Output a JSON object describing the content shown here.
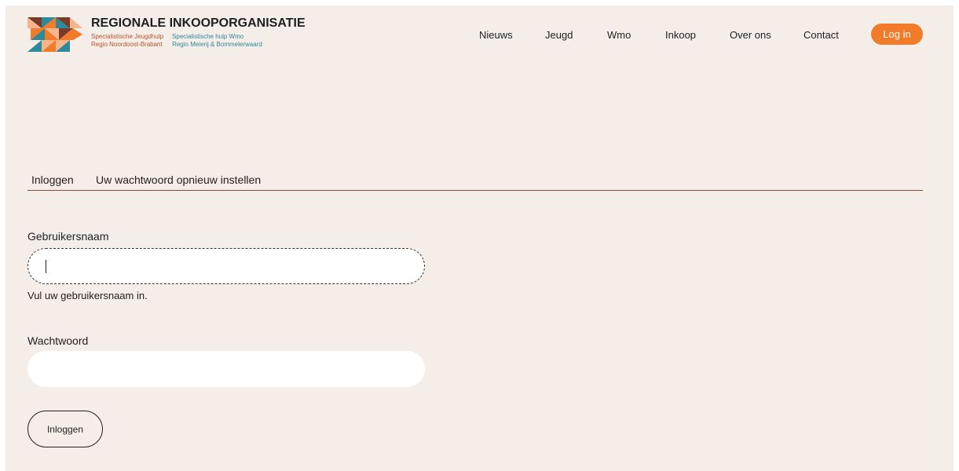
{
  "brand": {
    "title": "REGIONALE INKOOPORGANISATIE",
    "col1_line1": "Specialistische Jeugdhulp",
    "col1_line2": "Regio Noordoost-Brabant",
    "col2_line1": "Specialistische hulp Wmo",
    "col2_line2": "Regio Meierij & Bommelerwaard",
    "colors": {
      "orange": "#f27b29",
      "rust": "#b8542a",
      "teal": "#2d8a98",
      "brown": "#7a3a2a",
      "peach": "#f5b48c"
    }
  },
  "nav": {
    "items": [
      "Nieuws",
      "Jeugd",
      "Wmo",
      "Inkoop",
      "Over ons",
      "Contact"
    ],
    "login_label": "Log in"
  },
  "tabs": [
    "Inloggen",
    "Uw wachtwoord opnieuw instellen"
  ],
  "form": {
    "username_label": "Gebruikersnaam",
    "username_value": "",
    "username_hint": "Vul uw gebruikersnaam in.",
    "password_label": "Wachtwoord",
    "password_value": "",
    "submit_label": "Inloggen"
  },
  "colors": {
    "background": "#f5ede8",
    "accent": "#f27b29",
    "divider": "#8a4a3a"
  }
}
